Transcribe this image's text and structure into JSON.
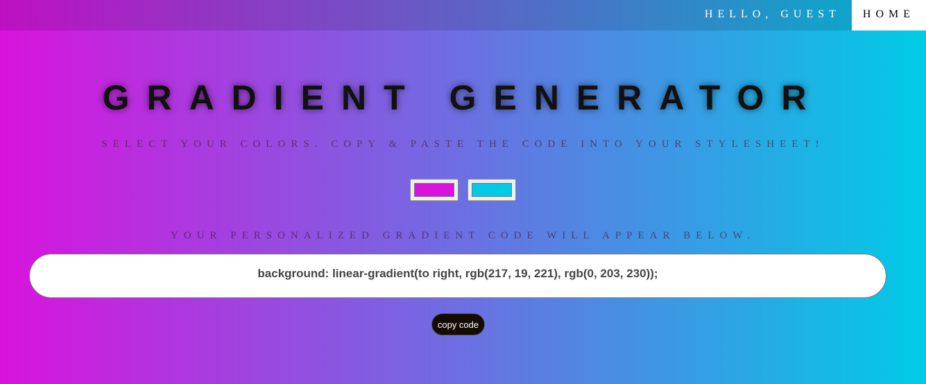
{
  "nav": {
    "greeting": "HELLO, GUEST",
    "home": "HOME"
  },
  "title": "GRADIENT GENERATOR",
  "subtitle": "SELECT YOUR COLORS. COPY & PASTE THE CODE INTO YOUR STYLESHEET!",
  "colors": {
    "color1": "#d913dd",
    "color2": "#00cbe6"
  },
  "code_label": "YOUR PERSONALIZED GRADIENT CODE WILL APPEAR BELOW.",
  "code": "background: linear-gradient(to right, rgb(217, 19, 221), rgb(0, 203, 230));",
  "copy_button": "copy code"
}
